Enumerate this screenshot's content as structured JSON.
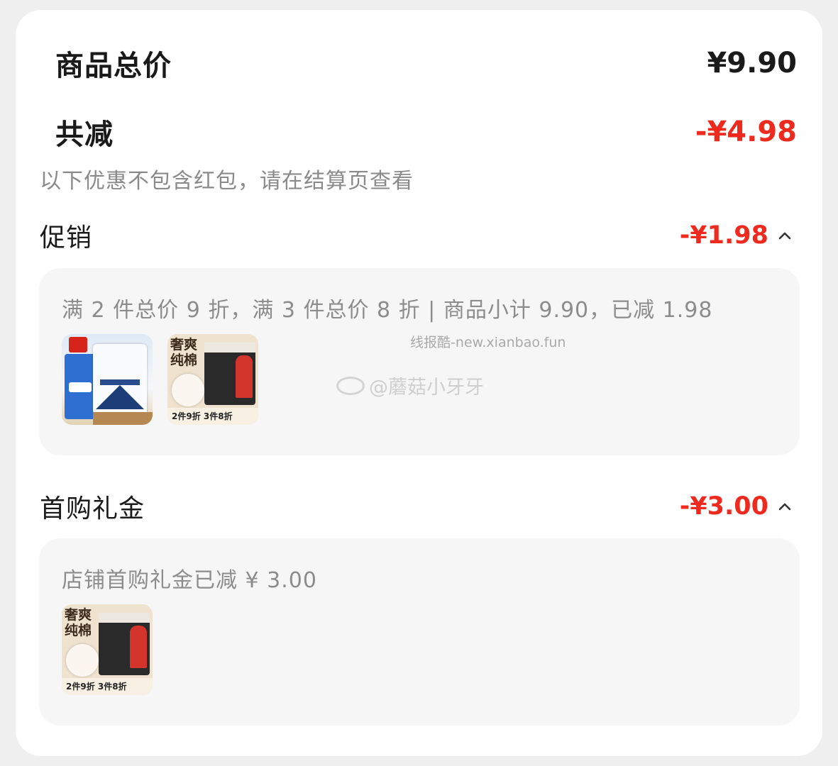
{
  "summary": {
    "total_label": "商品总价",
    "total_value": "¥9.90",
    "discount_label": "共减",
    "discount_value": "-¥4.98",
    "note": "以下优惠不包含红包，请在结算页查看"
  },
  "promotion": {
    "label": "促销",
    "value": "-¥1.98",
    "detail": "满 2 件总价 9 折，满 3 件总价 8 折 | 商品小计 9.90，已减 1.98",
    "products": [
      {
        "icon": "salt-product-image"
      },
      {
        "icon": "sanitary-pad-product-image",
        "title": "奢爽纯棉",
        "footer": "2件9折 3件8折"
      }
    ]
  },
  "first_purchase": {
    "label": "首购礼金",
    "value": "-¥3.00",
    "detail": "店铺首购礼金已减 ¥ 3.00",
    "products": [
      {
        "icon": "sanitary-pad-product-image",
        "title": "奢爽纯棉",
        "footer": "2件9折 3件8折"
      }
    ]
  },
  "watermarks": {
    "site": "线报酷-new.xianbao.fun",
    "weibo": "@蘑菇小牙牙"
  },
  "colors": {
    "accent_red": "#ee2a1f",
    "text_dark": "#1a1a1a",
    "text_gray": "#8a8a8a",
    "card_bg": "#ffffff",
    "box_bg": "#f6f6f6"
  }
}
